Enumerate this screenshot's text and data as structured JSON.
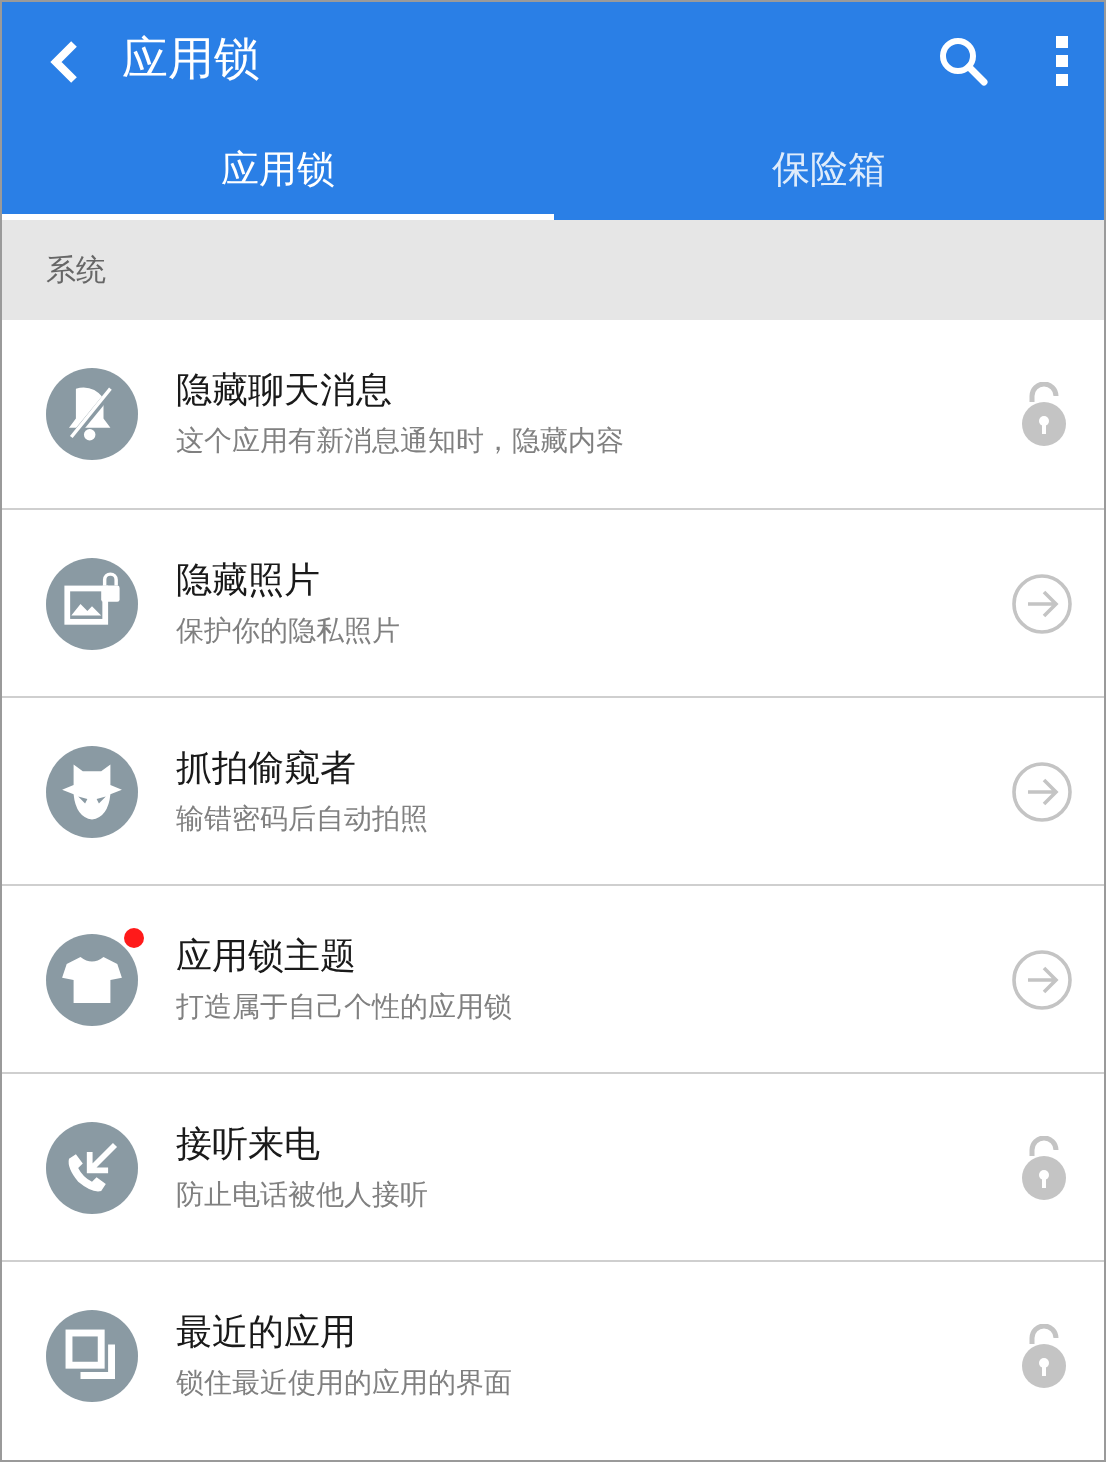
{
  "app_bar": {
    "title": "应用锁"
  },
  "tabs": [
    {
      "label": "应用锁",
      "selected": true
    },
    {
      "label": "保险箱",
      "selected": false
    }
  ],
  "section": {
    "title": "系统"
  },
  "items": [
    {
      "title": "隐藏聊天消息",
      "subtitle": "这个应用有新消息通知时，隐藏内容",
      "kind": "lock",
      "locked": false,
      "new_dot": false
    },
    {
      "title": "隐藏照片",
      "subtitle": "保护你的隐私照片",
      "kind": "arrow",
      "new_dot": false
    },
    {
      "title": "抓拍偷窥者",
      "subtitle": "输错密码后自动拍照",
      "kind": "arrow",
      "new_dot": false
    },
    {
      "title": "应用锁主题",
      "subtitle": "打造属于自己个性的应用锁",
      "kind": "arrow",
      "new_dot": true
    },
    {
      "title": "接听来电",
      "subtitle": "防止电话被他人接听",
      "kind": "lock",
      "locked": false,
      "new_dot": false
    },
    {
      "title": "最近的应用",
      "subtitle": "锁住最近使用的应用的界面",
      "kind": "lock",
      "locked": false,
      "new_dot": false
    }
  ]
}
